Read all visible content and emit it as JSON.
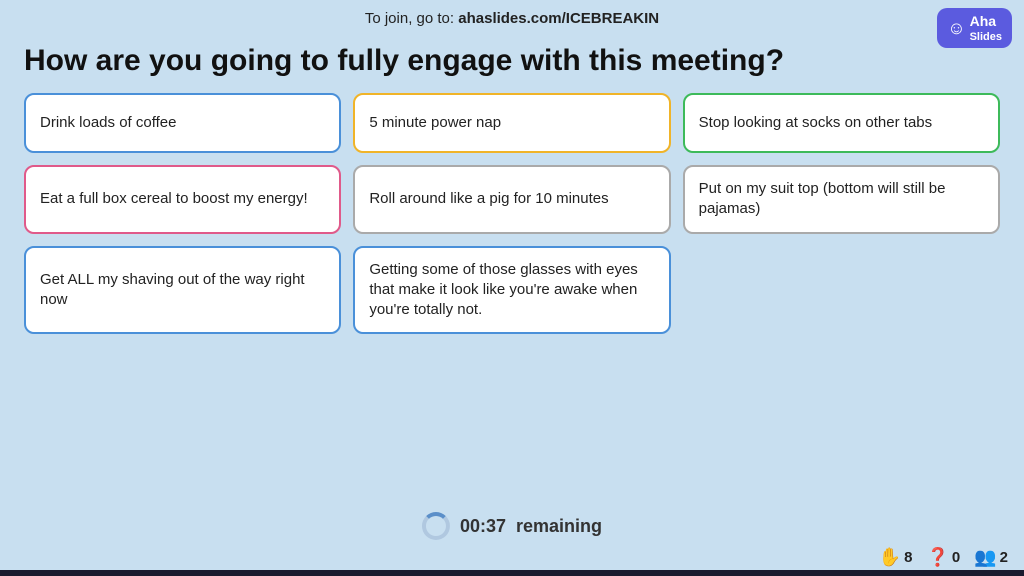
{
  "topbar": {
    "join_text": "To join, go to: ",
    "join_url": "ahaslides.com/ICEBREAKIN"
  },
  "logo": {
    "name": "Aha",
    "icon": "☺",
    "slides": "Slides"
  },
  "question": "How are you going to fully engage with this meeting?",
  "cards": [
    {
      "text": "Drink loads of coffee",
      "border": "border-blue"
    },
    {
      "text": "5 minute power nap",
      "border": "border-yellow"
    },
    {
      "text": "Stop looking at socks on other tabs",
      "border": "border-green"
    },
    {
      "text": "Eat a full box cereal to boost my energy!",
      "border": "border-pink"
    },
    {
      "text": "Roll around like a pig for 10 minutes",
      "border": "border-gray"
    },
    {
      "text": "Put on my suit top (bottom will still be pajamas)",
      "border": "border-gray"
    },
    {
      "text": "Get ALL my shaving out of the way right now",
      "border": "border-blue"
    },
    {
      "text": "Getting some of those glasses with eyes that make it look like you're awake when you're totally not.",
      "border": "border-blue"
    }
  ],
  "timer": {
    "value": "00:37",
    "label": "  remaining"
  },
  "stats": [
    {
      "icon": "✋",
      "value": "8",
      "name": "hands"
    },
    {
      "icon": "❓",
      "value": "0",
      "name": "questions"
    },
    {
      "icon": "👥",
      "value": "2",
      "name": "participants"
    }
  ]
}
